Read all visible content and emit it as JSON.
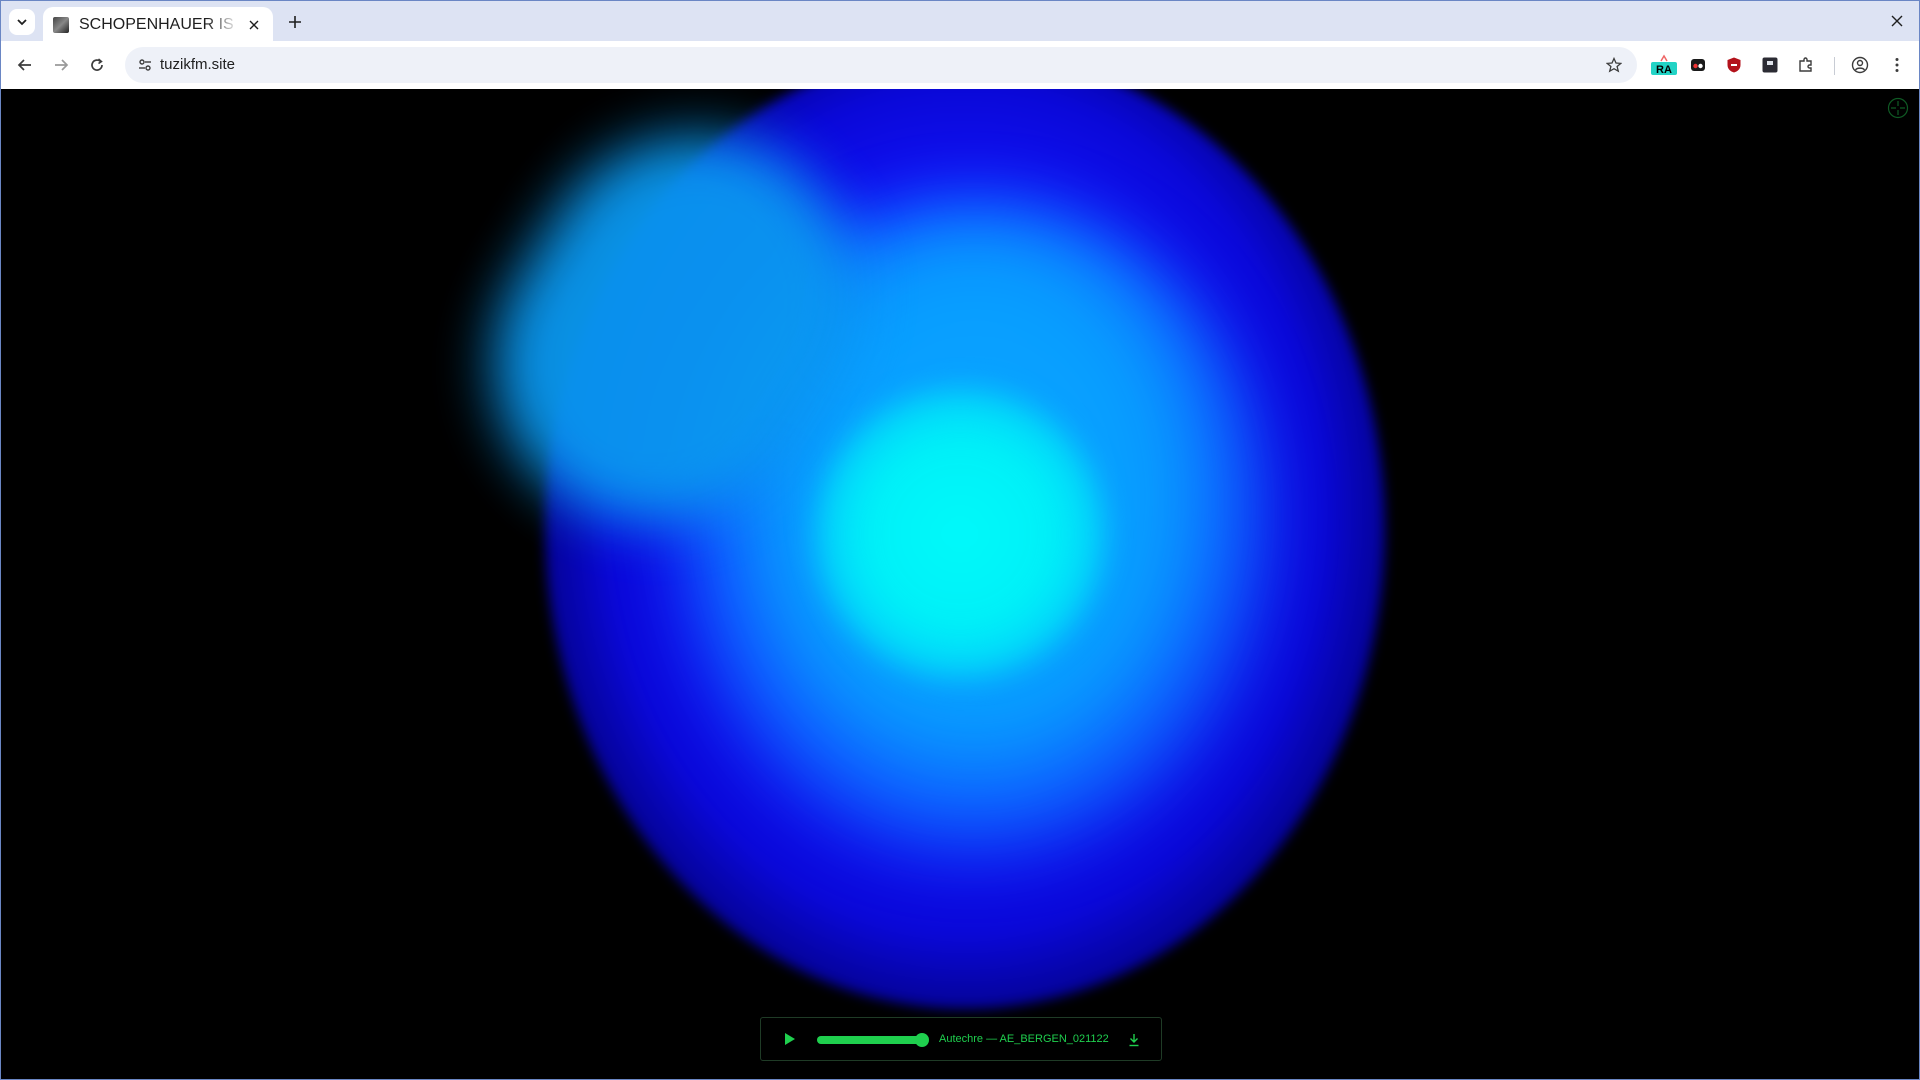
{
  "browser": {
    "tab": {
      "title": "SCHOPENHAUER IS",
      "favicon": "tuzik-favicon"
    },
    "url": "tuzikfm.site",
    "extensions": [
      {
        "name": "ra-extension-icon",
        "label": "RA"
      },
      {
        "name": "two-dots-extension-icon"
      },
      {
        "name": "shield-extension-icon"
      },
      {
        "name": "square-extension-icon"
      },
      {
        "name": "puzzle-extensions-icon"
      }
    ]
  },
  "player": {
    "progress_percent": 97,
    "track": "Autechre — AE_BERGEN_021122",
    "accent_color": "#1fcf4e"
  },
  "visual": {
    "colors": {
      "deep_blue": "#1416ff",
      "sky_blue": "#0a98f0",
      "cyan": "#00fafa"
    }
  }
}
